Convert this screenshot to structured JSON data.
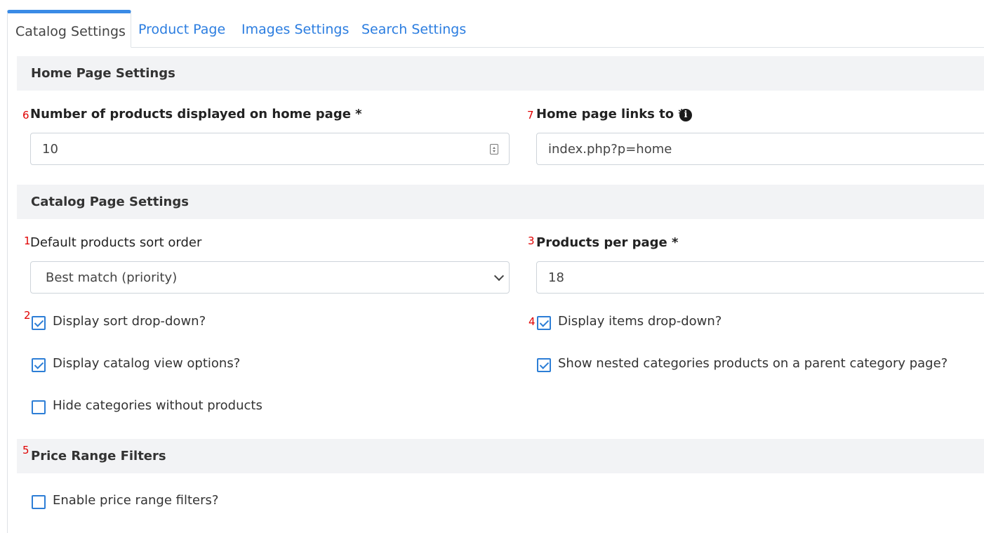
{
  "tabs": [
    {
      "label": "Catalog Settings",
      "active": true
    },
    {
      "label": "Product Page",
      "active": false
    },
    {
      "label": "Images Settings",
      "active": false
    },
    {
      "label": "Search Settings",
      "active": false
    }
  ],
  "sections": {
    "home": "Home Page Settings",
    "catalog": "Catalog Page Settings",
    "price": "Price Range Filters"
  },
  "markers": {
    "m1": "1",
    "m2": "2",
    "m3": "3",
    "m4": "4",
    "m5": "5",
    "m6": "6",
    "m7": "7"
  },
  "fields": {
    "num_products_label": "Number of products displayed on home page *",
    "num_products_value": "10",
    "home_links_label": "Home page links to *",
    "home_links_value": "index.php?p=home",
    "sort_order_label": "Default products sort order",
    "sort_order_value": "Best match (priority)",
    "per_page_label": "Products per page *",
    "per_page_value": "18"
  },
  "checkboxes": {
    "display_sort": {
      "label": "Display sort drop-down?",
      "checked": true
    },
    "display_items": {
      "label": "Display items drop-down?",
      "checked": true
    },
    "display_view": {
      "label": "Display catalog view options?",
      "checked": true
    },
    "show_nested": {
      "label": "Show nested categories products on a parent category page?",
      "checked": true
    },
    "hide_empty": {
      "label": "Hide categories without products",
      "checked": false
    },
    "price_filters": {
      "label": "Enable price range filters?",
      "checked": false
    }
  },
  "icons": {
    "info": "info-icon"
  }
}
